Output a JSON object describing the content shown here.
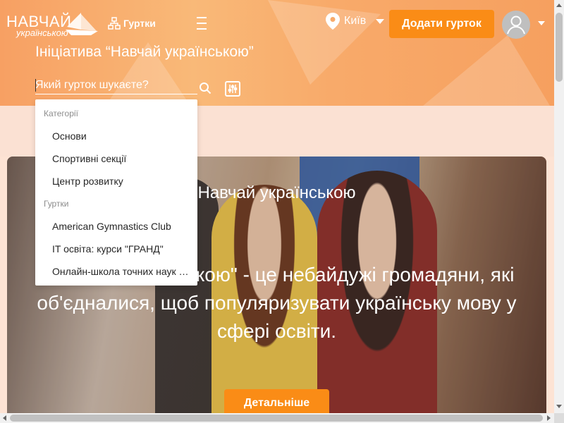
{
  "header": {
    "logo": {
      "line1": "НАВЧАЙ",
      "line2": "українською"
    },
    "clubs_link": "Гуртки",
    "city": "Київ",
    "add_club_button": "Додати гурток",
    "initiative_title": "Ініціатива “Навчай українською”"
  },
  "search": {
    "placeholder": "Який гурток шукаєте?",
    "dropdown": {
      "categories_label": "Категорії",
      "categories": [
        "Основи",
        "Спортивні секції",
        "Центр розвитку"
      ],
      "clubs_label": "Гуртки",
      "clubs": [
        "American Gymnastics Club",
        "IT освіта: курси \"ГРАНД\"",
        "Онлайн-школа точних наук \"Пітагор\""
      ]
    }
  },
  "hero": {
    "title": "Навчай українською",
    "text": "\"Навчай українською\" - це небайдужі громадяни, які об'єдналися, щоб популяризувати українську мову у сфері освіти.",
    "details_button": "Детальніше"
  },
  "colors": {
    "accent": "#fa8c16",
    "header_gradient": "#f8aa6a",
    "pink_band": "#fbe1d3"
  },
  "icons": [
    "paper-boat-logo-icon",
    "sitemap-icon",
    "menu-icon",
    "location-pin-icon",
    "caret-down-icon",
    "user-avatar-icon",
    "search-icon",
    "filter-icon"
  ]
}
